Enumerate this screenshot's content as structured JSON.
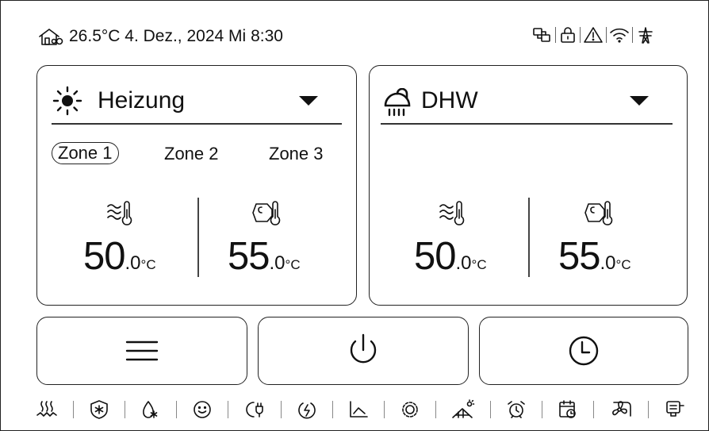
{
  "status": {
    "temperature": "26.5°C",
    "date": "4. Dez., 2024",
    "weekday": "Mi",
    "time": "8:30",
    "icons": [
      "network-link-icon",
      "lock-icon",
      "warning-icon",
      "wifi-icon",
      "grid-pylon-icon"
    ]
  },
  "heating": {
    "title": "Heizung",
    "icon": "sun-icon",
    "zones": [
      {
        "label": "Zone 1",
        "selected": true
      },
      {
        "label": "Zone 2",
        "selected": false
      },
      {
        "label": "Zone 3",
        "selected": false
      }
    ],
    "water_temp": {
      "int": "50",
      "dec": ".0",
      "unit": "°C",
      "icon": "water-thermometer-icon"
    },
    "tank_temp": {
      "int": "55",
      "dec": ".0",
      "unit": "°C",
      "icon": "tank-thermometer-icon"
    }
  },
  "dhw": {
    "title": "DHW",
    "icon": "shower-icon",
    "water_temp": {
      "int": "50",
      "dec": ".0",
      "unit": "°C",
      "icon": "water-thermometer-icon"
    },
    "tank_temp": {
      "int": "55",
      "dec": ".0",
      "unit": "°C",
      "icon": "tank-thermometer-icon"
    }
  },
  "buttons": {
    "menu": "menu-icon",
    "power": "power-icon",
    "schedule": "clock-icon"
  },
  "function_bar": [
    "heater-icon",
    "frost-protection-icon",
    "disinfect-icon",
    "comfort-icon",
    "smart-grid-icon",
    "power-save-icon",
    "chart-icon",
    "settings-gear-icon",
    "solar-house-icon",
    "alarm-clock-icon",
    "calendar-icon",
    "fan-icon",
    "display-icon"
  ],
  "colors": {
    "foreground": "#111111",
    "background": "#ffffff",
    "border": "#222222"
  }
}
